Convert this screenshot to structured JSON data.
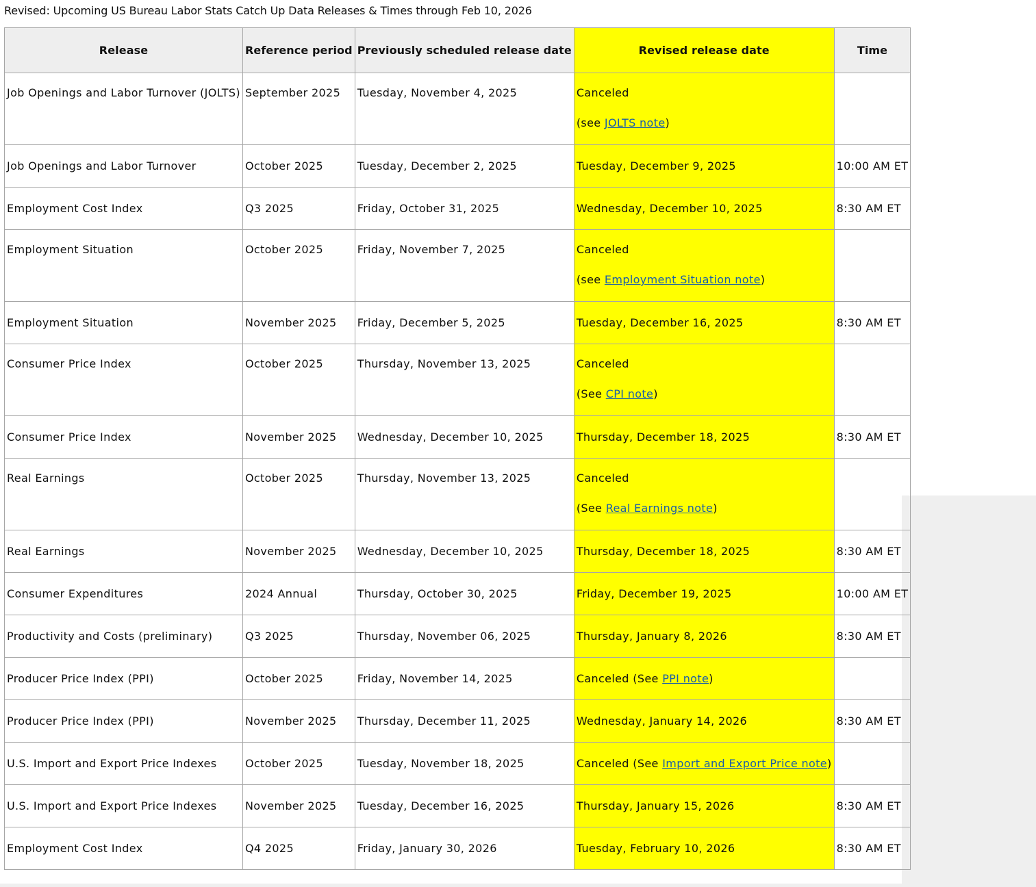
{
  "page": {
    "title": "Revised: Upcoming US Bureau Labor Stats Catch Up Data Releases & Times through Feb 10, 2026"
  },
  "colors": {
    "highlight": "#ffff00",
    "header_bg": "#eeeeee",
    "link": "#1a5fa8",
    "border": "#a6a6a6"
  },
  "table": {
    "headers": {
      "release": "Release",
      "reference_period": "Reference period",
      "previous_date": "Previously scheduled release date",
      "revised_date": "Revised release date",
      "time": "Time"
    },
    "rows": [
      {
        "release": "Job Openings and Labor Turnover (JOLTS)",
        "period": "September 2025",
        "previous": "Tuesday, November 4, 2025",
        "revised": "Canceled",
        "note_prefix": "(see ",
        "note_link": "JOLTS note",
        "note_suffix": ")",
        "time": ""
      },
      {
        "release": "Job Openings and Labor Turnover",
        "period": "October 2025",
        "previous": "Tuesday, December 2, 2025",
        "revised": "Tuesday, December 9, 2025",
        "time": "10:00 AM ET"
      },
      {
        "release": "Employment Cost Index",
        "period": "Q3 2025",
        "previous": "Friday, October 31, 2025",
        "revised": "Wednesday, December 10, 2025",
        "time": "8:30 AM ET"
      },
      {
        "release": "Employment Situation",
        "period": "October 2025",
        "previous": "Friday, November 7, 2025",
        "revised": "Canceled",
        "note_prefix": "(see ",
        "note_link": "Employment Situation note",
        "note_suffix": ")",
        "time": ""
      },
      {
        "release": "Employment Situation",
        "period": "November 2025",
        "previous": "Friday, December 5, 2025",
        "revised": "Tuesday, December 16, 2025",
        "time": "8:30 AM ET"
      },
      {
        "release": "Consumer Price Index",
        "period": "October 2025",
        "previous": "Thursday, November 13, 2025",
        "revised": "Canceled",
        "note_prefix": "(See ",
        "note_link": "CPI note",
        "note_suffix": ")",
        "time": ""
      },
      {
        "release": "Consumer Price Index",
        "period": "November 2025",
        "previous": "Wednesday, December 10, 2025",
        "revised": "Thursday, December 18, 2025",
        "time": "8:30 AM ET"
      },
      {
        "release": "Real Earnings",
        "period": "October 2025",
        "previous": "Thursday, November 13, 2025",
        "revised": "Canceled",
        "note_prefix": "(See ",
        "note_link": "Real Earnings note",
        "note_suffix": ")",
        "time": ""
      },
      {
        "release": "Real Earnings",
        "period": "November 2025",
        "previous": "Wednesday, December 10, 2025",
        "revised": "Thursday, December 18, 2025",
        "time": "8:30 AM ET"
      },
      {
        "release": "Consumer Expenditures",
        "period": "2024 Annual",
        "previous": "Thursday, October 30, 2025",
        "revised": "Friday, December 19, 2025",
        "time": "10:00 AM ET"
      },
      {
        "release": "Productivity and Costs (preliminary)",
        "period": "Q3 2025",
        "previous": "Thursday, November 06, 2025",
        "revised": "Thursday, January 8, 2026",
        "time": "8:30 AM ET"
      },
      {
        "release": "Producer Price Index (PPI)",
        "period": "October 2025",
        "previous": "Friday, November 14, 2025",
        "revised": "Canceled (See ",
        "inline_link": "PPI note",
        "inline_suffix": ")",
        "time": ""
      },
      {
        "release": "Producer Price Index (PPI)",
        "period": "November 2025",
        "previous": "Thursday, December 11, 2025",
        "revised": "Wednesday, January 14, 2026",
        "time": "8:30 AM ET"
      },
      {
        "release": "U.S. Import and Export Price Indexes",
        "period": "October 2025",
        "previous": "Tuesday, November 18, 2025",
        "revised": "Canceled (See ",
        "inline_link": "Import and Export Price note",
        "inline_suffix": ")",
        "time": ""
      },
      {
        "release": "U.S. Import and Export Price Indexes",
        "period": "November 2025",
        "previous": "Tuesday, December 16, 2025",
        "revised": "Thursday, January 15, 2026",
        "time": "8:30 AM ET"
      },
      {
        "release": "Employment Cost Index",
        "period": "Q4 2025",
        "previous": "Friday, January 30, 2026",
        "revised": "Tuesday, February 10, 2026",
        "time": "8:30 AM ET"
      }
    ]
  }
}
